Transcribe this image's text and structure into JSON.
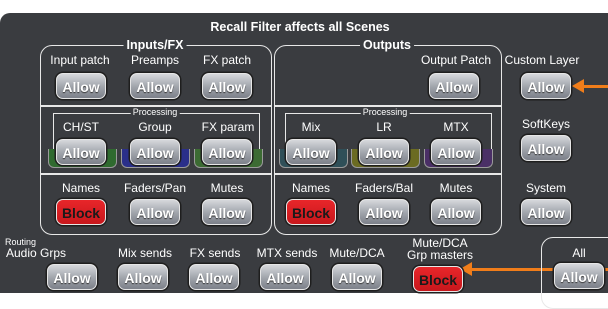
{
  "header": "Recall Filter affects all Scenes",
  "inputs_fx": {
    "title": "Inputs/FX",
    "top": [
      {
        "label": "Input patch",
        "button": "Allow"
      },
      {
        "label": "Preamps",
        "button": "Allow"
      },
      {
        "label": "FX patch",
        "button": "Allow"
      }
    ],
    "processing_label": "Processing",
    "processing": [
      {
        "label": "CH/ST",
        "button": "Allow"
      },
      {
        "label": "Group",
        "button": "Allow"
      },
      {
        "label": "FX param",
        "button": "Allow"
      }
    ],
    "bottom": [
      {
        "label": "Names",
        "button": "Block"
      },
      {
        "label": "Faders/Pan",
        "button": "Allow"
      },
      {
        "label": "Mutes",
        "button": "Allow"
      }
    ]
  },
  "outputs": {
    "title": "Outputs",
    "top": [
      {
        "label": "Output Patch",
        "button": "Allow"
      }
    ],
    "processing_label": "Processing",
    "processing": [
      {
        "label": "Mix",
        "button": "Allow"
      },
      {
        "label": "LR",
        "button": "Allow"
      },
      {
        "label": "MTX",
        "button": "Allow"
      }
    ],
    "bottom": [
      {
        "label": "Names",
        "button": "Block"
      },
      {
        "label": "Faders/Bal",
        "button": "Allow"
      },
      {
        "label": "Mutes",
        "button": "Allow"
      }
    ]
  },
  "right_column": [
    {
      "label": "Custom Layer",
      "button": "Allow"
    },
    {
      "label": "SoftKeys",
      "button": "Allow"
    },
    {
      "label": "System",
      "button": "Allow"
    }
  ],
  "routing": {
    "label": "Routing",
    "items": [
      {
        "label": "Audio Grps",
        "button": "Allow"
      },
      {
        "label": "Mix sends",
        "button": "Allow"
      },
      {
        "label": "FX sends",
        "button": "Allow"
      },
      {
        "label": "MTX sends",
        "button": "Allow"
      },
      {
        "label": "Mute/DCA",
        "button": "Allow"
      }
    ]
  },
  "grp_masters": {
    "label_line1": "Mute/DCA",
    "label_line2": "Grp masters",
    "button": "Block"
  },
  "all": {
    "label": "All",
    "button": "Allow"
  },
  "colors": {
    "panel": "#3a3c40",
    "accent_arrow": "#f07d1a",
    "block_red": "#d41f24",
    "group_band": "#2a2f8a",
    "fxparam_band": "#3c6b33",
    "mix_band": "#2f4f58",
    "lr_band": "#6b6b22",
    "mtx_band": "#4a2f66",
    "chst_band": "#2f6a2f"
  }
}
